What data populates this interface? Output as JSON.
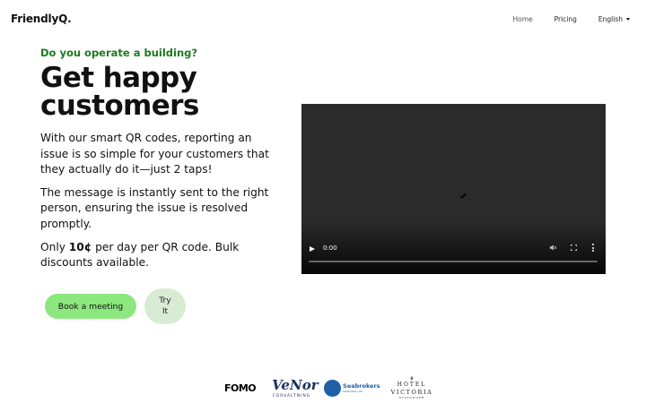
{
  "header": {
    "logo": "FriendlyQ.",
    "nav": {
      "home": "Home",
      "pricing": "Pricing",
      "language": "English"
    }
  },
  "hero": {
    "eyebrow": "Do you operate a building?",
    "headline_line1": "Get happy",
    "headline_line2": "customers",
    "paragraph1": "With our smart QR codes, reporting an issue is so simple for your customers that they actually do it—just 2 taps!",
    "paragraph2": "The message is instantly sent to the right person, ensuring the issue is resolved promptly.",
    "paragraph3_prefix": "Only ",
    "paragraph3_bold": "10¢",
    "paragraph3_suffix": " per day per QR code. Bulk discounts available.",
    "book_button": "Book a meeting",
    "try_line1": "Try",
    "try_line2": "It"
  },
  "video": {
    "time": "0:00",
    "progress": 0
  },
  "partners": {
    "fomo": "FOMO",
    "venor": "VeNor",
    "venor_sub": "FORVALTNING",
    "seabrokers": "Seabrokers",
    "seabrokers_sub": "Seabrokers AS",
    "hotel_line1": "HOTEL",
    "hotel_line2": "VICTORIA",
    "hotel_line3": "STAVANGER"
  },
  "colors": {
    "eyebrow": "#1f7a1f",
    "primary_button": "#8de77f",
    "secondary_button": "#d8ecd4",
    "video_bg": "#2b2b2b"
  },
  "icons": {
    "play": "play-icon",
    "mute": "mute-icon",
    "fullscreen": "fullscreen-icon",
    "more": "more-icon",
    "caret": "chevron-down-icon"
  }
}
